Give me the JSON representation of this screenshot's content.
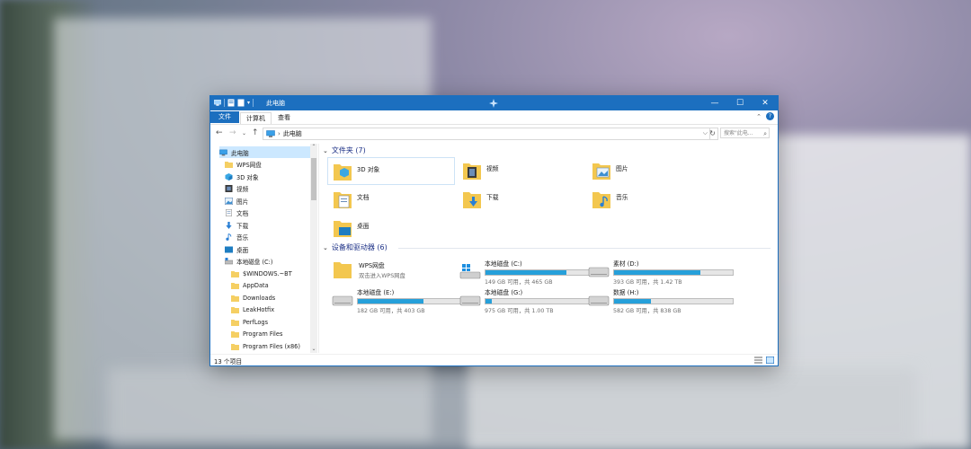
{
  "window": {
    "title": "此电脑",
    "controls": {
      "minimize": "—",
      "maximize": "☐",
      "close": "✕"
    }
  },
  "ribbon": {
    "tabs": [
      "文件",
      "计算机",
      "查看"
    ]
  },
  "address": {
    "path": "此电脑",
    "search_placeholder": "搜索\"此电...",
    "dropdown": "⌵",
    "refresh": "↻"
  },
  "sidebar": {
    "items": [
      {
        "label": "此电脑",
        "icon": "pc-icon",
        "selected": true
      },
      {
        "label": "WPS网盘",
        "icon": "folder-icon"
      },
      {
        "label": "3D 对象",
        "icon": "cube-icon"
      },
      {
        "label": "视频",
        "icon": "video-icon"
      },
      {
        "label": "图片",
        "icon": "picture-icon"
      },
      {
        "label": "文档",
        "icon": "document-icon"
      },
      {
        "label": "下载",
        "icon": "download-icon"
      },
      {
        "label": "音乐",
        "icon": "music-icon"
      },
      {
        "label": "桌面",
        "icon": "desktop-icon"
      },
      {
        "label": "本地磁盘 (C:)",
        "icon": "drive-icon"
      },
      {
        "label": "$WINDOWS.~BT",
        "icon": "folder-icon"
      },
      {
        "label": "AppData",
        "icon": "folder-icon"
      },
      {
        "label": "Downloads",
        "icon": "folder-icon"
      },
      {
        "label": "LeakHotfix",
        "icon": "folder-icon"
      },
      {
        "label": "PerfLogs",
        "icon": "folder-icon"
      },
      {
        "label": "Program Files",
        "icon": "folder-icon"
      },
      {
        "label": "Program Files (x86)",
        "icon": "folder-icon"
      }
    ]
  },
  "folders": {
    "heading": "文件夹 (7)",
    "items": [
      {
        "label": "3D 对象",
        "icon": "3d-objects-folder-icon"
      },
      {
        "label": "视频",
        "icon": "videos-folder-icon"
      },
      {
        "label": "图片",
        "icon": "pictures-folder-icon"
      },
      {
        "label": "文档",
        "icon": "documents-folder-icon"
      },
      {
        "label": "下载",
        "icon": "downloads-folder-icon"
      },
      {
        "label": "音乐",
        "icon": "music-folder-icon"
      },
      {
        "label": "桌面",
        "icon": "desktop-folder-icon"
      }
    ]
  },
  "devices": {
    "heading": "设备和驱动器 (6)",
    "wps": {
      "name": "WPS网盘",
      "subtitle": "双击进入WPS网盘"
    },
    "drives": [
      {
        "name": "本地磁盘 (C:)",
        "free": "149 GB 可用，共 465 GB",
        "used_fraction": 0.68,
        "icon": "windows-drive-icon"
      },
      {
        "name": "素材 (D:)",
        "free": "393 GB 可用，共 1.42 TB",
        "used_fraction": 0.73,
        "icon": "hard-drive-icon"
      },
      {
        "name": "本地磁盘 (E:)",
        "free": "182 GB 可用，共 403 GB",
        "used_fraction": 0.55,
        "icon": "hard-drive-icon"
      },
      {
        "name": "本地磁盘 (G:)",
        "free": "975 GB 可用，共 1.00 TB",
        "used_fraction": 0.05,
        "icon": "hard-drive-icon"
      },
      {
        "name": "数据 (H:)",
        "free": "582 GB 可用，共 838 GB",
        "used_fraction": 0.31,
        "icon": "hard-drive-icon"
      }
    ]
  },
  "status": {
    "count": "13 个项目"
  },
  "colors": {
    "accent": "#1c6fbf",
    "bar_fill": "#26a0da",
    "heading": "#1e3287",
    "selection": "#cce8ff"
  }
}
